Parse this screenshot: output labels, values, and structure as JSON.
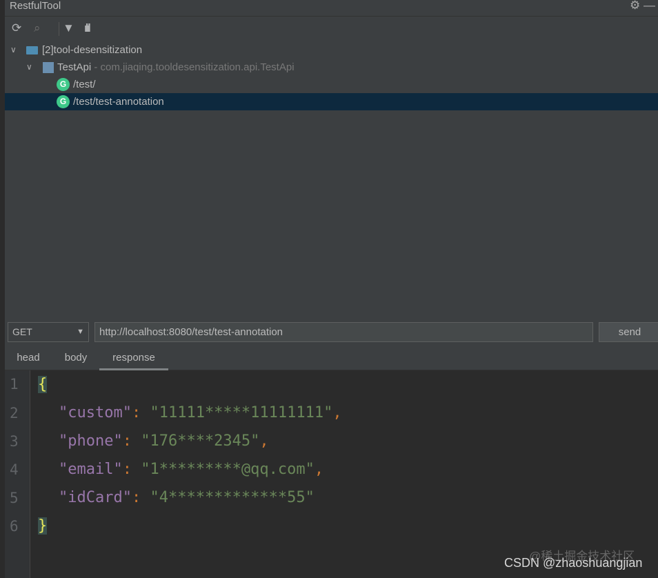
{
  "window": {
    "title": "RestfulTool"
  },
  "toolbar": {
    "icons": [
      "refresh-icon",
      "search-icon",
      "filter-icon",
      "bar-columns-icon"
    ]
  },
  "tree": {
    "project": "[2]tool-desensitization",
    "class_name": "TestApi",
    "class_qualified": "- com.jiaqing.tooldesensitization.api.TestApi",
    "endpoints": [
      {
        "method_badge": "G",
        "path": "/test/"
      },
      {
        "method_badge": "G",
        "path": "/test/test-annotation",
        "selected": true
      }
    ]
  },
  "request": {
    "method": "GET",
    "url": "http://localhost:8080/test/test-annotation",
    "send_label": "send"
  },
  "tabs": [
    {
      "label": "head"
    },
    {
      "label": "body"
    },
    {
      "label": "response",
      "active": true
    }
  ],
  "response": {
    "line_numbers": [
      "1",
      "2",
      "3",
      "4",
      "5",
      "6"
    ],
    "open": "{",
    "close": "}",
    "fields": [
      {
        "key": "\"custom\"",
        "value": "\"11111*****11111111\"",
        "comma": ","
      },
      {
        "key": "\"phone\"",
        "value": "\"176****2345\"",
        "comma": ","
      },
      {
        "key": "\"email\"",
        "value": "\"1*********@qq.com\"",
        "comma": ","
      },
      {
        "key": "\"idCard\"",
        "value": "\"4*************55\"",
        "comma": ""
      }
    ]
  },
  "watermark": {
    "line1": "@稀土掘金技术社区",
    "line2": "CSDN @zhaoshuangjian"
  },
  "colors": {
    "selection": "#0d293e",
    "json_key": "#9876aa",
    "json_string": "#6a8759",
    "punct": "#cc7832",
    "get_badge": "#3ec98a"
  }
}
